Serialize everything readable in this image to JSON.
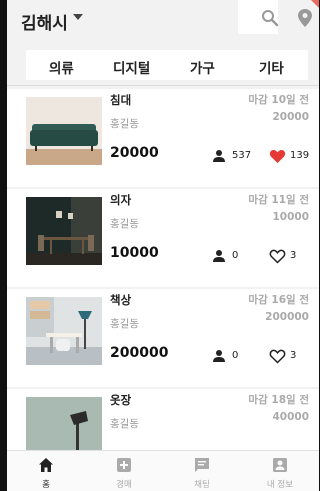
{
  "header": {
    "region": "김해시"
  },
  "categories": [
    "의류",
    "디지털",
    "가구",
    "기타"
  ],
  "items": [
    {
      "title": "침대",
      "location": "홍길동",
      "deadline": "마감 10일 전",
      "start_value": "20000",
      "price": "20000",
      "participants": "537",
      "likes": "139",
      "liked": true
    },
    {
      "title": "의자",
      "location": "홍길동",
      "deadline": "마감 11일 전",
      "start_value": "10000",
      "price": "10000",
      "participants": "0",
      "likes": "3",
      "liked": false
    },
    {
      "title": "책상",
      "location": "홍길동",
      "deadline": "마감 16일 전",
      "start_value": "200000",
      "price": "200000",
      "participants": "0",
      "likes": "3",
      "liked": false
    },
    {
      "title": "옷장",
      "location": "홍길동",
      "deadline": "마감 18일 전",
      "start_value": "40000"
    }
  ],
  "nav": [
    "홈",
    "경매",
    "채팅",
    "내 정보"
  ],
  "colors": {
    "accent": "#e53935",
    "background": "#f2f2f2"
  }
}
